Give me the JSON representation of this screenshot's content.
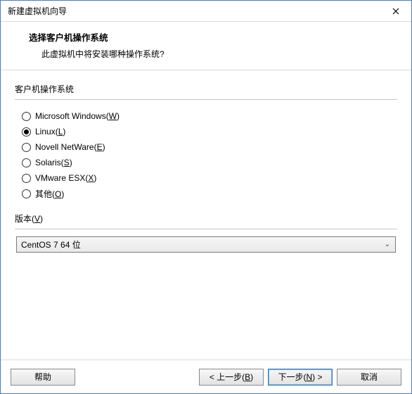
{
  "titlebar": {
    "title": "新建虚拟机向导"
  },
  "header": {
    "heading": "选择客户机操作系统",
    "subheading": "此虚拟机中将安装哪种操作系统?"
  },
  "os_group": {
    "label": "客户机操作系统",
    "options": [
      {
        "text": "Microsoft Windows(",
        "hotkey": "W",
        "suffix": ")",
        "checked": false
      },
      {
        "text": "Linux(",
        "hotkey": "L",
        "suffix": ")",
        "checked": true
      },
      {
        "text": "Novell NetWare(",
        "hotkey": "E",
        "suffix": ")",
        "checked": false
      },
      {
        "text": "Solaris(",
        "hotkey": "S",
        "suffix": ")",
        "checked": false
      },
      {
        "text": "VMware ESX(",
        "hotkey": "X",
        "suffix": ")",
        "checked": false
      },
      {
        "text": "其他(",
        "hotkey": "O",
        "suffix": ")",
        "checked": false
      }
    ]
  },
  "version": {
    "label_text": "版本(",
    "label_hotkey": "V",
    "label_suffix": ")",
    "selected": "CentOS 7 64 位"
  },
  "footer": {
    "help": "帮助",
    "back_prefix": "< 上一步(",
    "back_hotkey": "B",
    "back_suffix": ")",
    "next_prefix": "下一步(",
    "next_hotkey": "N",
    "next_suffix": ") >",
    "cancel": "取消"
  }
}
